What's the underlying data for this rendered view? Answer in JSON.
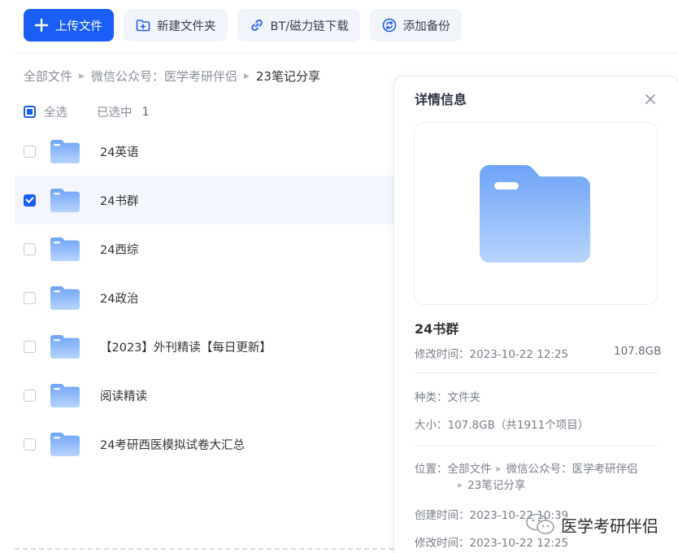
{
  "toolbar": {
    "upload": "上传文件",
    "new_folder": "新建文件夹",
    "bt_download": "BT/磁力链下载",
    "add_backup": "添加备份"
  },
  "breadcrumb": {
    "items": [
      "全部文件",
      "微信公众号：医学考研伴侣"
    ],
    "current": "23笔记分享"
  },
  "selection": {
    "select_all": "全选",
    "selected_label": "已选中",
    "selected_count": "1"
  },
  "files": [
    {
      "name": "24英语",
      "checked": false
    },
    {
      "name": "24书群",
      "checked": true
    },
    {
      "name": "24西综",
      "checked": false
    },
    {
      "name": "24政治",
      "checked": false
    },
    {
      "name": "【2023】外刊精读【每日更新】",
      "checked": false
    },
    {
      "name": "阅读精读",
      "checked": false
    },
    {
      "name": "24考研西医模拟试卷大汇总",
      "checked": false
    }
  ],
  "details": {
    "title": "详情信息",
    "name": "24书群",
    "modified_line": "修改时间：2023-10-22 12:25",
    "size_short": "107.8GB",
    "type_line": "种类：文件夹",
    "size_line": "大小：107.8GB（共1911个项目）",
    "location_label": "位置：",
    "location_1": "全部文件",
    "location_2": "微信公众号：医学考研伴侣",
    "location_3": "23笔记分享",
    "created_line": "创建时间：2023-10-22 10:39",
    "modified_line_2": "修改时间：2023-10-22 12:25"
  },
  "watermark": "医学考研伴侣",
  "colors": {
    "accent": "#1a5ef5",
    "folder_top": "#6fa3f7",
    "folder_bottom": "#b8d4fd"
  }
}
